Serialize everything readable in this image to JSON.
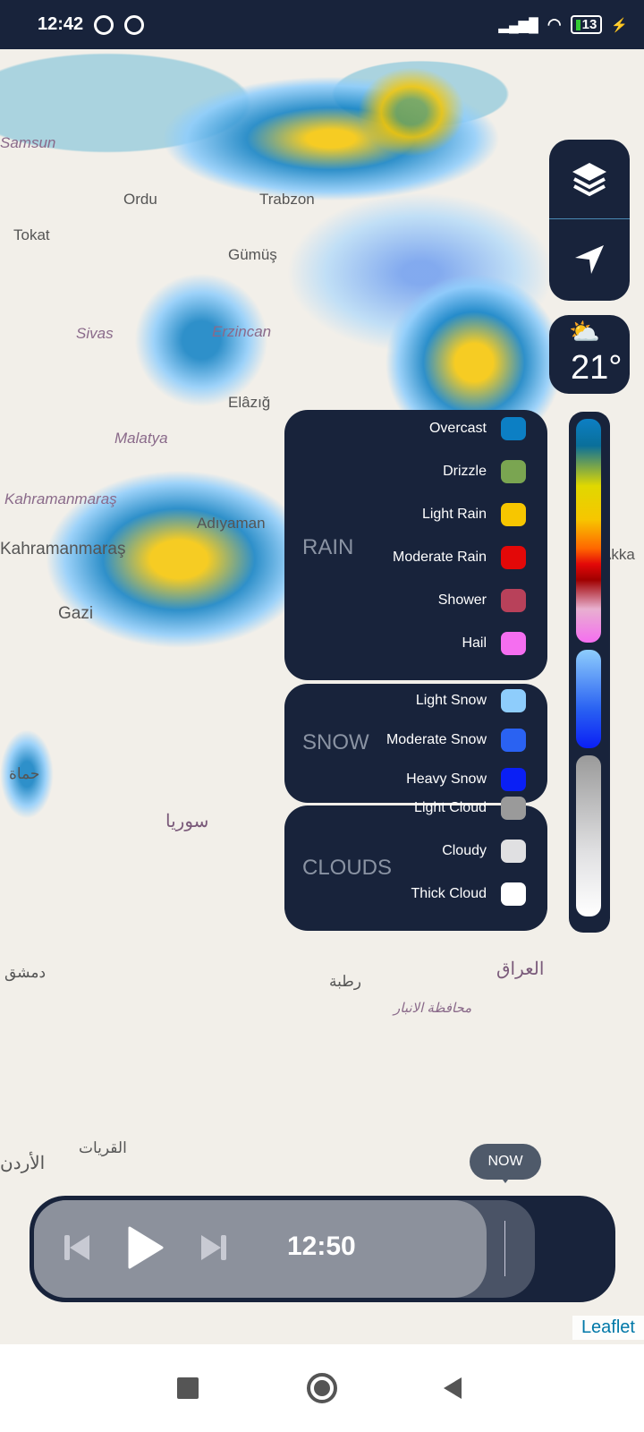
{
  "status_bar": {
    "time": "12:42",
    "battery": "13"
  },
  "map": {
    "labels": [
      "Samsun",
      "Ordu",
      "Trabzon",
      "Tokat",
      "Gümüş",
      "Sivas",
      "Erzincan",
      "Elâzığ",
      "Malatya",
      "Kahramanmaraş",
      "Kahramanmaraş",
      "Gazi",
      "Adıyaman",
      "حماة",
      "سوريا",
      "العراق",
      "رطبة",
      "دمشق",
      "الأردن",
      "القريات",
      "محافظة الانبار",
      "Akka"
    ],
    "attribution": "Leaflet"
  },
  "controls": {
    "layers_icon": "layers-icon",
    "locate_icon": "navigation-arrow-icon",
    "weather": {
      "icon": "partly-cloudy-rain-icon",
      "temperature": "21°"
    }
  },
  "legend": {
    "rain": {
      "title": "RAIN",
      "items": [
        {
          "label": "Overcast",
          "color": "#0c7fc4"
        },
        {
          "label": "Drizzle",
          "color": "#7aa551"
        },
        {
          "label": "Light Rain",
          "color": "#f7c600"
        },
        {
          "label": "Moderate Rain",
          "color": "#e30808"
        },
        {
          "label": "Shower",
          "color": "#b8415a"
        },
        {
          "label": "Hail",
          "color": "#f56ef0"
        }
      ]
    },
    "snow": {
      "title": "SNOW",
      "items": [
        {
          "label": "Light Snow",
          "color": "#8ecdfc"
        },
        {
          "label": "Moderate Snow",
          "color": "#2a62f2"
        },
        {
          "label": "Heavy Snow",
          "color": "#0a1ff5"
        }
      ]
    },
    "clouds": {
      "title": "CLOUDS",
      "items": [
        {
          "label": "Light Cloud",
          "color": "#9a9a9a"
        },
        {
          "label": "Cloudy",
          "color": "#e0e0e2"
        },
        {
          "label": "Thick Cloud",
          "color": "#ffffff"
        }
      ]
    }
  },
  "player": {
    "time": "12:50",
    "now_label": "NOW",
    "progress_percent": 80
  }
}
